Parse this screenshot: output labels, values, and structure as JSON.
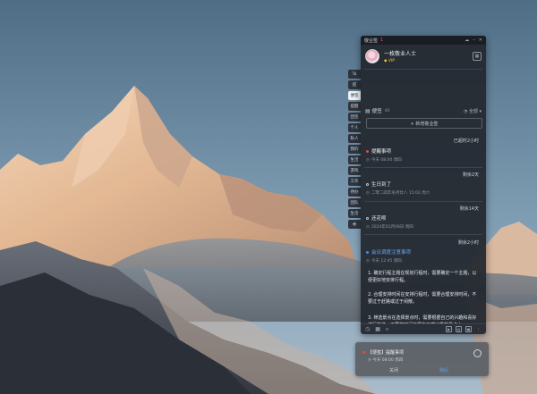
{
  "app": {
    "title": "敬业签",
    "notification_count": "1",
    "titlebar_icons": [
      "cloud-icon",
      "minimize-icon",
      "close-icon"
    ]
  },
  "profile": {
    "username": "一枚敬业人士",
    "vip_label": "VIP"
  },
  "list": {
    "name": "便签",
    "count": "40",
    "filter_label": "全部",
    "add_button": "+ 新增敬业签"
  },
  "items": [
    {
      "section": "已超时2小时",
      "title": "提醒事项",
      "meta": "今天 08:00 周四",
      "dot": "red"
    },
    {
      "section": "剩余2天",
      "title": "生日到了",
      "meta": "二零二四年冬月廿八 15:02 周六",
      "dot": "none"
    },
    {
      "section": "剩余14天",
      "title": "还花呗",
      "meta": "2024年01月08日 周四",
      "dot": "none"
    },
    {
      "section": "剩余2小时",
      "title": "会议调度注意事项",
      "meta": "今天 12:45 周四",
      "dot": "blue"
    }
  ],
  "note": {
    "paragraphs": [
      "1. 确定行程主题在规划行程时，需要确定一个主题，以便更好地安排行程。",
      "2. 合理安排时间在安排行程时，需要合理安排时间，不要过于赶路或过于闲散。",
      "3. 筛选景点在选择景点时，需要根据自己的兴趣和喜好进行筛选，不要将时间浪费在不感兴趣的景点上。"
    ]
  },
  "side_tabs": [
    "Ta",
    "提",
    "便签",
    "提醒",
    "团签",
    "个人",
    "私人",
    "我的",
    "生活",
    "游戏",
    "工作",
    "待办",
    "团队",
    "生活"
  ],
  "bottom_icons": [
    "clock-icon",
    "calendar-icon",
    "search-icon",
    "play-icon",
    "layout-icon",
    "image-icon",
    "more-icon"
  ],
  "toast": {
    "title": "【便签】提醒事项",
    "time": "今天 08:00 周四",
    "close_label": "关闭",
    "later_label": "稍后"
  },
  "colors": {
    "panel_bg": "#242930",
    "accent_red": "#e04c4c",
    "accent_blue": "#4a8ad8",
    "vip_gold": "#f2c94c"
  }
}
